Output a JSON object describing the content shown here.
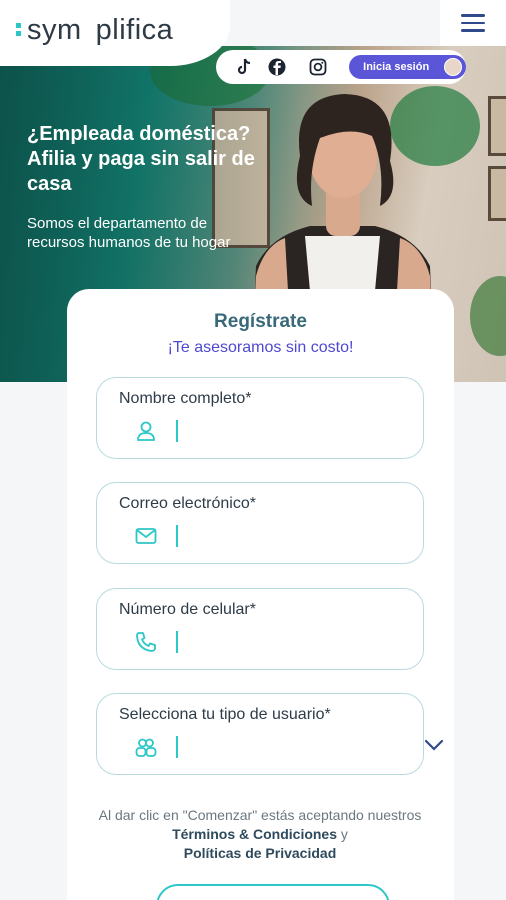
{
  "brand": {
    "logo_left": "sym",
    "logo_right": "plifica",
    "accent": "#2cc7c7",
    "primary": "#5b55d8"
  },
  "header": {
    "menu_icon": "hamburger-icon"
  },
  "social": {
    "icons": [
      "tiktok-icon",
      "facebook-icon",
      "instagram-icon"
    ],
    "login_label": "Inicia sesión"
  },
  "hero": {
    "title": "¿Empleada doméstica? Afilia y paga sin salir de casa",
    "subtitle": "Somos el departamento de recursos humanos de tu hogar"
  },
  "form": {
    "title": "Regístrate",
    "subtitle": "¡Te asesoramos sin costo!",
    "fields": [
      {
        "label": "Nombre completo*",
        "icon": "user-icon",
        "value": ""
      },
      {
        "label": "Correo electrónico*",
        "icon": "mail-icon",
        "value": ""
      },
      {
        "label": "Número de celular*",
        "icon": "phone-icon",
        "value": ""
      },
      {
        "label": "Selecciona tu tipo de usuario*",
        "icon": "users-icon",
        "value": ""
      }
    ],
    "terms_prefix": "Al dar clic en \"Comenzar\" estás aceptando nuestros ",
    "terms_link": "Términos & Condiciones",
    "terms_and": " y ",
    "privacy_link": "Políticas de Privacidad"
  }
}
